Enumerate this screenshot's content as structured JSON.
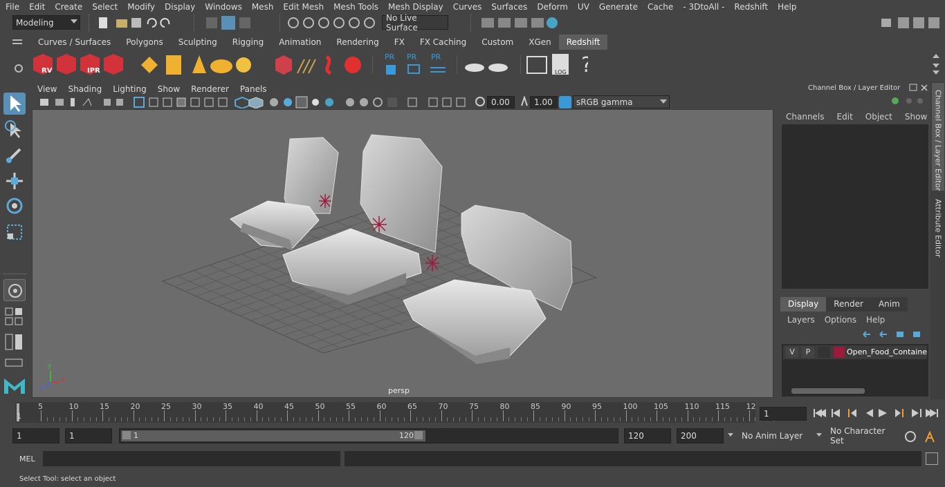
{
  "menubar": {
    "items": [
      "File",
      "Edit",
      "Create",
      "Select",
      "Modify",
      "Display",
      "Windows",
      "Mesh",
      "Edit Mesh",
      "Mesh Tools",
      "Mesh Display",
      "Curves",
      "Surfaces",
      "Deform",
      "UV",
      "Generate",
      "Cache",
      "- 3DtoAll -",
      "Redshift",
      "Help"
    ]
  },
  "statusline": {
    "workspace": "Modeling",
    "live_surface": "No Live Surface"
  },
  "shelf_tabs": [
    "Curves / Surfaces",
    "Polygons",
    "Sculpting",
    "Rigging",
    "Animation",
    "Rendering",
    "FX",
    "FX Caching",
    "Custom",
    "XGen",
    "Redshift"
  ],
  "active_shelf_tab": "Redshift",
  "shelf_labels": {
    "rv": "RV",
    "ipr": "IPR",
    "pr1": "PR",
    "pr2": "PR",
    "pr3": "PR",
    "log": "LOG",
    "help": "?"
  },
  "viewport": {
    "menu": [
      "View",
      "Shading",
      "Lighting",
      "Show",
      "Renderer",
      "Panels"
    ],
    "exposure": "0.00",
    "gamma": "1.00",
    "color_space": "sRGB gamma",
    "camera_label": "persp",
    "axis": {
      "x": "x",
      "y": "y",
      "z": "z"
    }
  },
  "channel_box": {
    "title": "Channel Box / Layer Editor",
    "menu": [
      "Channels",
      "Edit",
      "Object",
      "Show"
    ]
  },
  "layer_editor": {
    "tabs": [
      "Display",
      "Render",
      "Anim"
    ],
    "active_tab": "Display",
    "menu": [
      "Layers",
      "Options",
      "Help"
    ],
    "layer": {
      "v": "V",
      "p": "P",
      "name": "Open_Food_Containe",
      "color": "#9e1a3c"
    }
  },
  "side_tabs": [
    "Channel Box / Layer Editor",
    "Attribute Editor"
  ],
  "timeline": {
    "ticks": [
      "5",
      "10",
      "15",
      "20",
      "25",
      "30",
      "35",
      "40",
      "45",
      "50",
      "55",
      "60",
      "65",
      "70",
      "75",
      "80",
      "85",
      "90",
      "95",
      "100",
      "105",
      "110",
      "115",
      "12"
    ],
    "start_label": "1",
    "current_frame": "1"
  },
  "range": {
    "start": "1",
    "playback_start": "1",
    "slider_start": "1",
    "slider_end": "120",
    "playback_end": "120",
    "end": "200",
    "anim_layer": "No Anim Layer",
    "character_set": "No Character Set"
  },
  "mel": {
    "label": "MEL"
  },
  "help_line": "Select Tool: select an object"
}
